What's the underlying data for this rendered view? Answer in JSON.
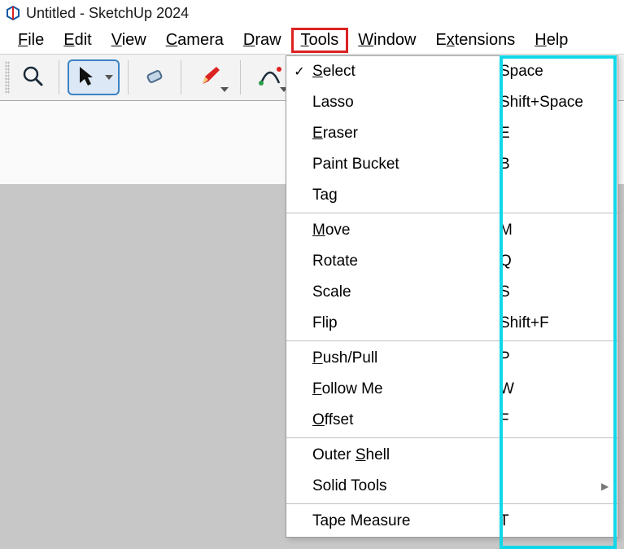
{
  "title": "Untitled - SketchUp 2024",
  "menubar": {
    "file": "File",
    "edit": "Edit",
    "view": "View",
    "camera": "Camera",
    "draw": "Draw",
    "tools": "Tools",
    "window": "Window",
    "extensions": "Extensions",
    "help": "Help"
  },
  "tools_menu": {
    "groups": [
      [
        {
          "label": "Select",
          "u": "S",
          "rest": "elect",
          "shortcut": "Space",
          "checked": true
        },
        {
          "label": "Lasso",
          "u": "",
          "rest": "Lasso",
          "shortcut": "Shift+Space"
        },
        {
          "label": "Eraser",
          "u": "E",
          "rest": "raser",
          "shortcut": "E"
        },
        {
          "label": "Paint Bucket",
          "u": "",
          "rest": "Paint Bucket",
          "shortcut": "B"
        },
        {
          "label": "Tag",
          "u": "",
          "rest": "Tag",
          "shortcut": ""
        }
      ],
      [
        {
          "label": "Move",
          "u": "M",
          "rest": "ove",
          "shortcut": "M"
        },
        {
          "label": "Rotate",
          "u": "",
          "rest": "Rotate",
          "shortcut": "Q"
        },
        {
          "label": "Scale",
          "u": "",
          "rest": "Scale",
          "shortcut": "S"
        },
        {
          "label": "Flip",
          "u": "",
          "rest": "Flip",
          "shortcut": "Shift+F"
        }
      ],
      [
        {
          "label": "Push/Pull",
          "u": "P",
          "rest": "ush/Pull",
          "shortcut": "P"
        },
        {
          "label": "Follow Me",
          "u": "F",
          "rest": "ollow Me",
          "shortcut": "W"
        },
        {
          "label": "Offset",
          "u": "O",
          "rest": "ffset",
          "shortcut": "F"
        }
      ],
      [
        {
          "label": "Outer Shell",
          "u": "",
          "rest": "Outer ",
          "u2": "S",
          "rest2": "hell",
          "shortcut": ""
        },
        {
          "label": "Solid Tools",
          "u": "",
          "rest": "Solid Tools",
          "shortcut": "",
          "submenu": true
        }
      ],
      [
        {
          "label": "Tape Measure",
          "u": "",
          "rest": "Tape Measure",
          "shortcut": "T"
        }
      ]
    ]
  },
  "annotation": {
    "highlight_menu": "Tools",
    "highlight_shortcut_column": true
  }
}
